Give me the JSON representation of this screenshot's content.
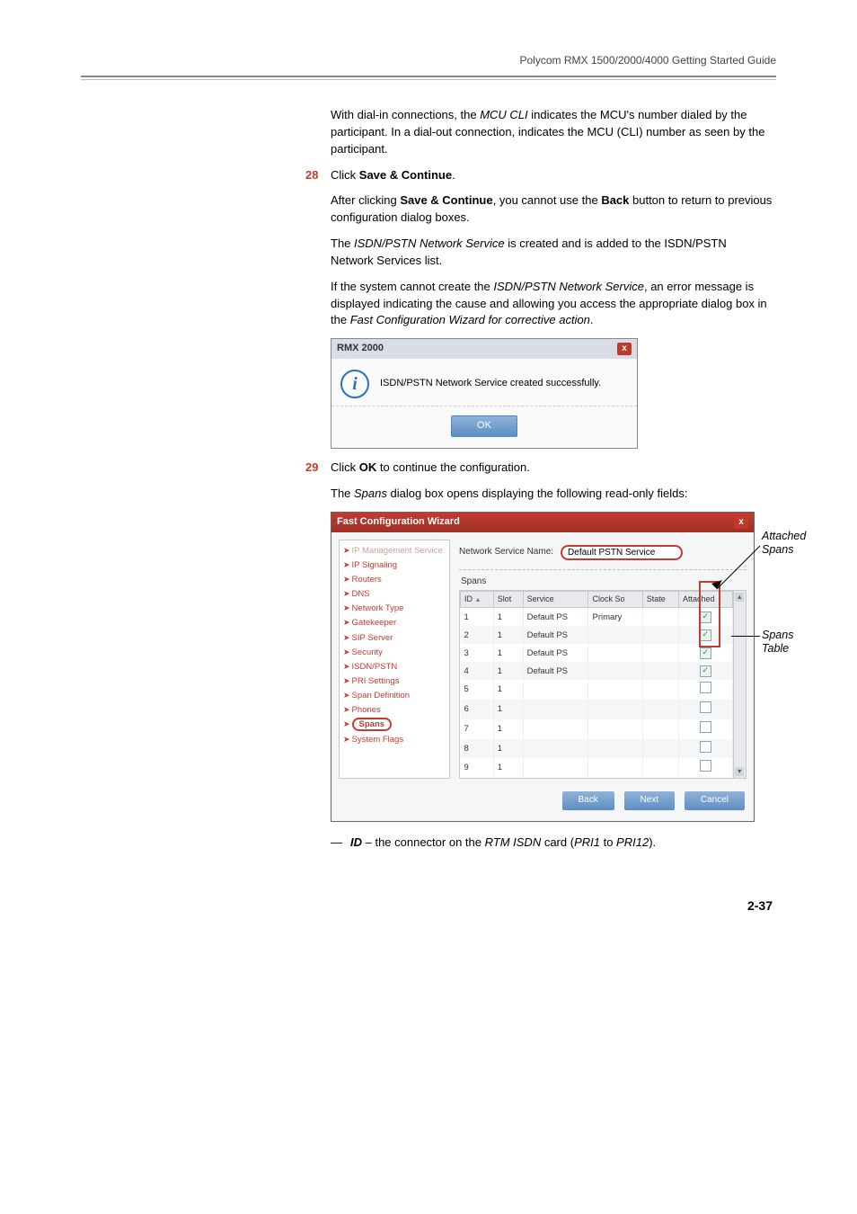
{
  "header": {
    "guide_title": "Polycom RMX 1500/2000/4000 Getting Started Guide"
  },
  "body": {
    "p1_a": "With dial-in connections, the ",
    "p1_em": "MCU CLI",
    "p1_b": " indicates the MCU's number dialed by the participant. In a dial-out connection, indicates the MCU (CLI) number as seen by the participant.",
    "step28_num": "28",
    "step28_a": "Click ",
    "step28_b": "Save & Continue",
    "step28_c": ".",
    "p2_a": "After clicking ",
    "p2_b": "Save & Continue",
    "p2_c": ", you cannot use the ",
    "p2_d": "Back",
    "p2_e": " button to return to previous configuration dialog boxes.",
    "p3_a": "The ",
    "p3_em": "ISDN/PSTN Network Service",
    "p3_b": " is created and is added to the ISDN/PSTN Network Services list.",
    "p4_a": "If the system cannot create the ",
    "p4_em1": "ISDN/PSTN Network Service",
    "p4_b": ", an error message is displayed indicating the cause and allowing you access the appropriate dialog box in the ",
    "p4_em2": "Fast Configuration Wizard for corrective action",
    "p4_c": ".",
    "step29_num": "29",
    "step29_a": "Click ",
    "step29_b": "OK",
    "step29_c": " to continue the configuration.",
    "p5_a": "The ",
    "p5_em": "Spans",
    "p5_b": " dialog box opens displaying the following read-only fields:",
    "foot_dash": "—",
    "foot_em": "ID",
    "foot_a": " – the connector on the ",
    "foot_em2": "RTM ISDN",
    "foot_b": " card (",
    "foot_em3": "PRI1",
    "foot_c": " to ",
    "foot_em4": "PRI12",
    "foot_d": ")."
  },
  "msgbox": {
    "title": "RMX 2000",
    "close": "x",
    "text": "ISDN/PSTN Network Service created successfully.",
    "ok": "OK"
  },
  "wizard": {
    "title": "Fast Configuration Wizard",
    "close": "x",
    "side": {
      "items": [
        {
          "label": "IP Management Service",
          "dim": true
        },
        {
          "label": "IP Signaling",
          "dim": false
        },
        {
          "label": "Routers",
          "dim": false
        },
        {
          "label": "DNS",
          "dim": false
        },
        {
          "label": "Network Type",
          "dim": false
        },
        {
          "label": "Gatekeeper",
          "dim": false
        },
        {
          "label": "SIP Server",
          "dim": false
        },
        {
          "label": "Security",
          "dim": false
        },
        {
          "label": "ISDN/PSTN",
          "dim": false
        },
        {
          "label": "PRI Settings",
          "dim": false
        },
        {
          "label": "Span Definition",
          "dim": false
        },
        {
          "label": "Phones",
          "dim": false
        },
        {
          "label": "Spans",
          "dim": false,
          "selected": true
        },
        {
          "label": "System Flags",
          "dim": false
        }
      ]
    },
    "main": {
      "ns_label": "Network Service Name:",
      "ns_value": "Default PSTN Service",
      "spans_label": "Spans",
      "cols": [
        "ID",
        "Slot",
        "Service",
        "Clock So",
        "State",
        "Attached"
      ],
      "rows": [
        {
          "id": "1",
          "slot": "1",
          "service": "Default PS",
          "clock": "Primary",
          "state": "",
          "attached": true
        },
        {
          "id": "2",
          "slot": "1",
          "service": "Default PS",
          "clock": "",
          "state": "",
          "attached": true
        },
        {
          "id": "3",
          "slot": "1",
          "service": "Default PS",
          "clock": "",
          "state": "",
          "attached": true
        },
        {
          "id": "4",
          "slot": "1",
          "service": "Default PS",
          "clock": "",
          "state": "",
          "attached": true
        },
        {
          "id": "5",
          "slot": "1",
          "service": "",
          "clock": "",
          "state": "",
          "attached": false
        },
        {
          "id": "6",
          "slot": "1",
          "service": "",
          "clock": "",
          "state": "",
          "attached": false
        },
        {
          "id": "7",
          "slot": "1",
          "service": "",
          "clock": "",
          "state": "",
          "attached": false
        },
        {
          "id": "8",
          "slot": "1",
          "service": "",
          "clock": "",
          "state": "",
          "attached": false
        },
        {
          "id": "9",
          "slot": "1",
          "service": "",
          "clock": "",
          "state": "",
          "attached": false
        }
      ]
    },
    "buttons": {
      "back": "Back",
      "next": "Next",
      "cancel": "Cancel"
    }
  },
  "annot": {
    "attached_spans": "Attached Spans",
    "spans_table": "Spans Table"
  },
  "page_num": "2-37"
}
